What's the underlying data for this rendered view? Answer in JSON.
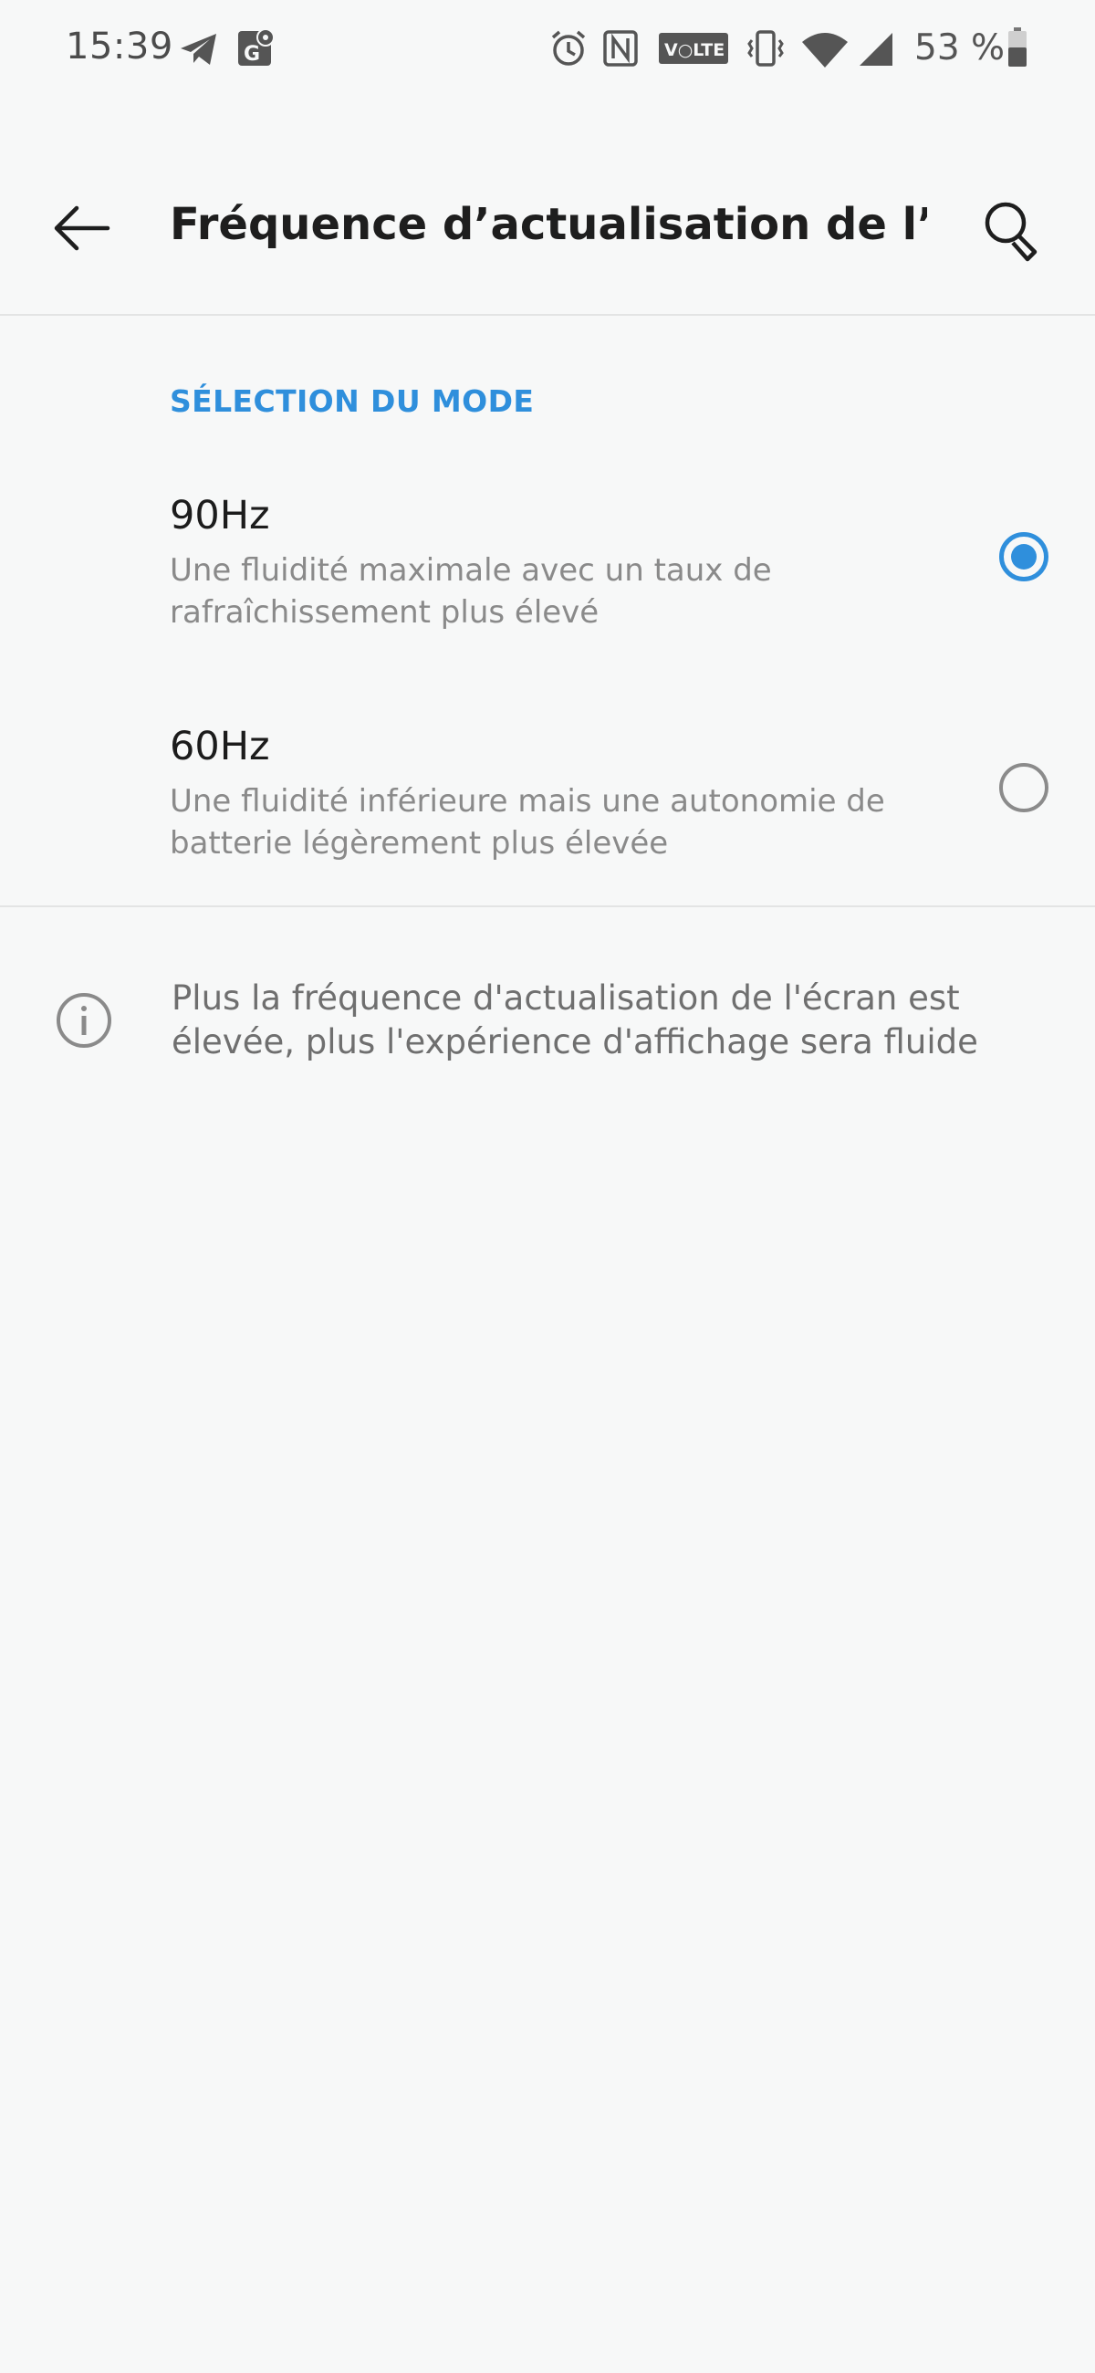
{
  "status_bar": {
    "time": "15:39",
    "battery_percent": "53 %",
    "icons": [
      "telegram-icon",
      "maps-icon",
      "alarm-icon",
      "nfc-icon",
      "volte-icon",
      "vibrate-icon",
      "wifi-icon",
      "signal-icon",
      "battery-icon"
    ]
  },
  "app_bar": {
    "title": "Fréquence d’actualisation de l’éc…",
    "back_icon": "arrow-left-icon",
    "search_icon": "search-icon"
  },
  "section": {
    "header": "SÉLECTION DU MODE"
  },
  "options": [
    {
      "title": "90Hz",
      "description": "Une fluidité maximale avec un taux de rafraîchissement plus élevé",
      "selected": true
    },
    {
      "title": "60Hz",
      "description": "Une fluidité inférieure mais une autonomie de batterie légèrement plus élevée",
      "selected": false
    }
  ],
  "info": {
    "icon": "info-icon",
    "text": "Plus la fréquence d'actualisation de l'écran est élevée, plus l'expérience d'affichage sera fluide"
  },
  "colors": {
    "accent": "#2f8fdc",
    "background": "#f7f8f8",
    "divider": "#e3e4e4"
  }
}
